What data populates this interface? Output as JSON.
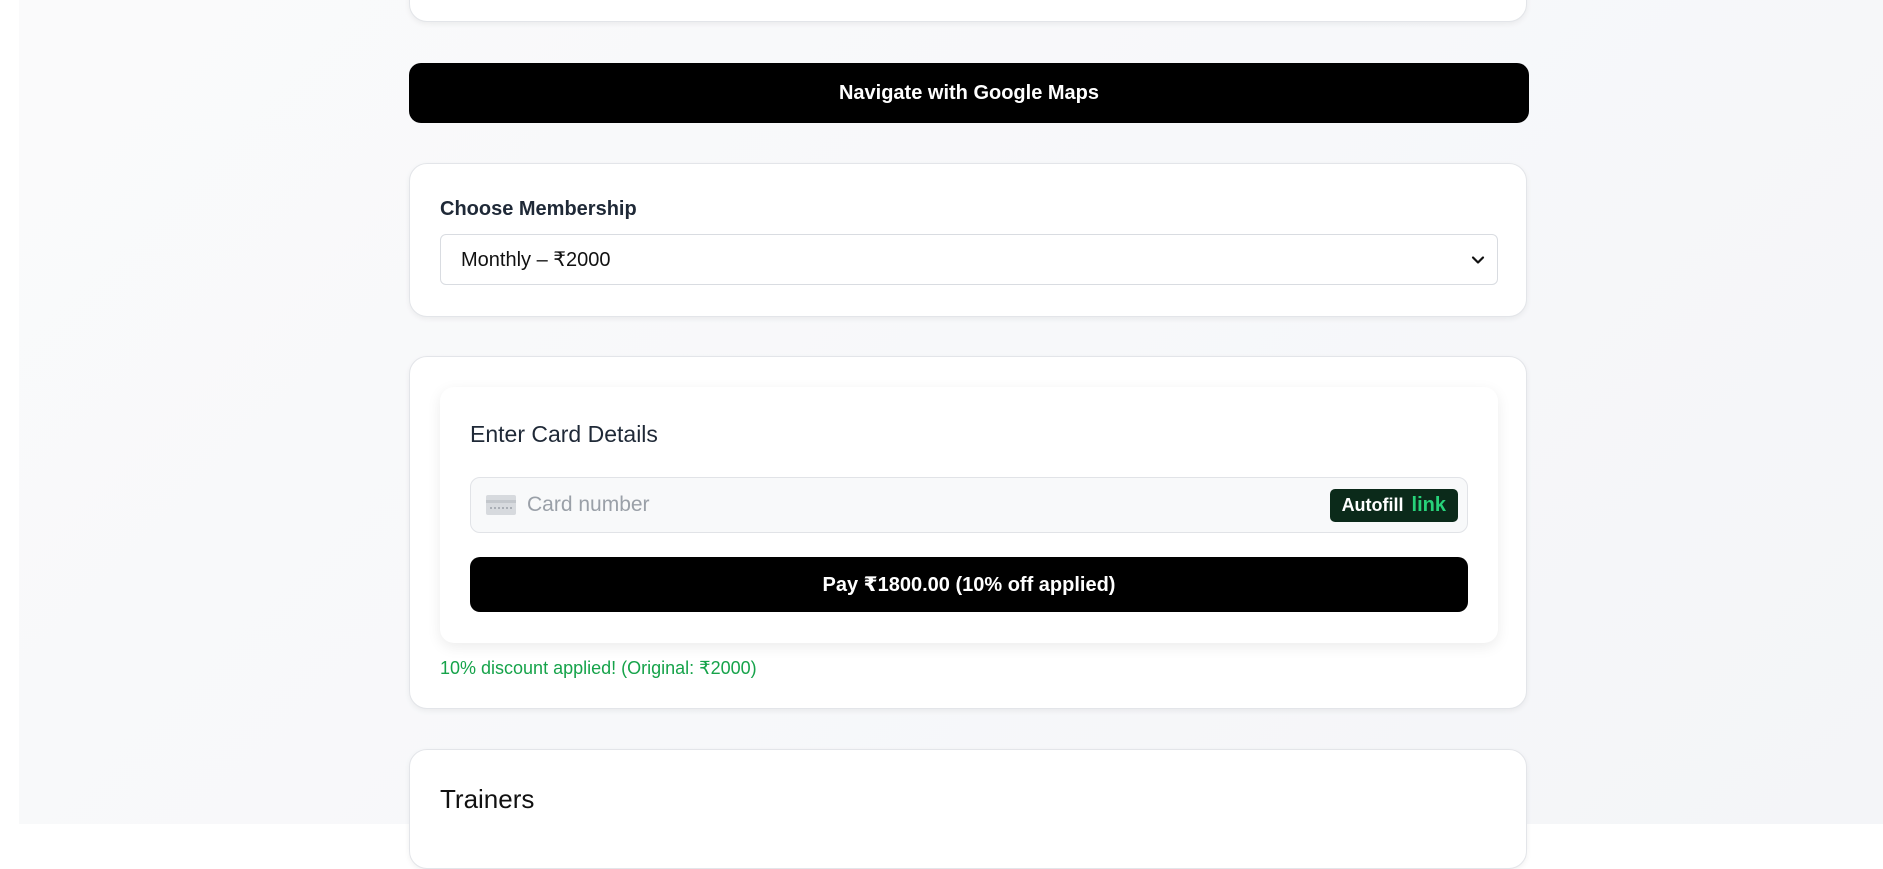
{
  "navigation": {
    "maps_button_label": "Navigate with Google Maps"
  },
  "membership": {
    "label": "Choose Membership",
    "selected_option": "Monthly – ₹2000"
  },
  "payment": {
    "title": "Enter Card Details",
    "card_number_placeholder": "Card number",
    "autofill_label": "Autofill",
    "link_label": "link",
    "pay_button_label": "Pay ₹1800.00 (10% off applied)",
    "discount_message": "10% discount applied! (Original: ₹2000)"
  },
  "trainers": {
    "title": "Trainers"
  },
  "colors": {
    "primary_button": "#000000",
    "discount_text": "#16a34a",
    "autofill_bg": "#0b2a1a",
    "link_green": "#27d37a"
  },
  "icons": {
    "card": "credit-card-icon",
    "dropdown": "chevron-down-icon"
  }
}
